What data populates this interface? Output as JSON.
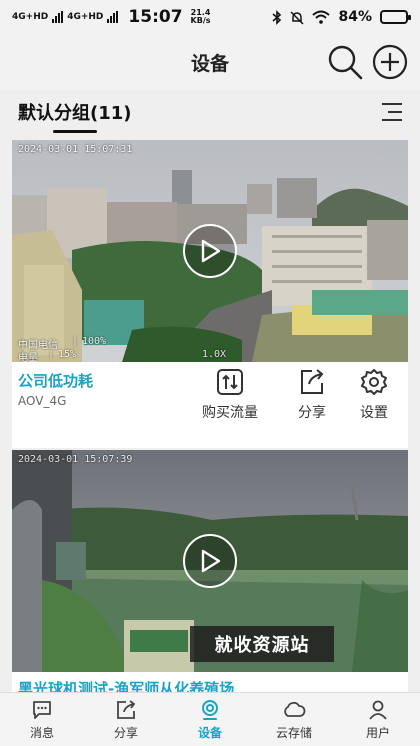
{
  "status_bar": {
    "sim1": "4G+HD",
    "sim2": "4G+HD",
    "time": "15:07",
    "net_speed_value": "21.4",
    "net_speed_unit": "KB/s",
    "battery_percent": "84%",
    "battery_level": 0.84
  },
  "header": {
    "title": "设备",
    "search_icon": "search-icon",
    "add_icon": "plus-circle-icon"
  },
  "group": {
    "title": "默认分组(11)",
    "menu_icon": "list-menu-icon"
  },
  "devices": [
    {
      "timestamp": "2024-03-01  15:07:31",
      "carrier_label": "中国电信",
      "signal_value": "100%",
      "battery_label": "电量",
      "battery_value": "15%",
      "zoom": "1.0X",
      "name": "公司低功耗",
      "model": "AOV_4G",
      "actions": [
        {
          "label": "购买流量",
          "icon": "data-transfer-icon"
        },
        {
          "label": "分享",
          "icon": "share-icon"
        },
        {
          "label": "设置",
          "icon": "gear-icon"
        }
      ]
    },
    {
      "timestamp": "2024-03-01  15:07:39",
      "name": "黑光球机测试-渔军师从化养殖场"
    }
  ],
  "watermark": "就收资源站",
  "bottom_nav": [
    {
      "label": "消息",
      "icon": "message-icon",
      "active": false
    },
    {
      "label": "分享",
      "icon": "share-icon",
      "active": false
    },
    {
      "label": "设备",
      "icon": "camera-icon",
      "active": true
    },
    {
      "label": "云存储",
      "icon": "cloud-icon",
      "active": false
    },
    {
      "label": "用户",
      "icon": "user-icon",
      "active": false
    }
  ],
  "colors": {
    "accent": "#1aa3c7",
    "background": "#efefef"
  }
}
